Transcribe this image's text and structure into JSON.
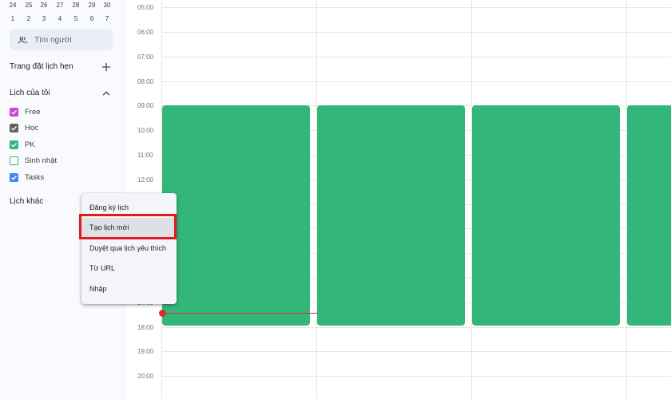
{
  "mini_calendar": {
    "row1": [
      "24",
      "25",
      "26",
      "27",
      "28",
      "29",
      "30"
    ],
    "row2": [
      "1",
      "2",
      "3",
      "4",
      "5",
      "6",
      "7"
    ]
  },
  "search_people": {
    "placeholder": "Tìm người"
  },
  "booking_pages": {
    "title": "Trang đặt lịch hẹn"
  },
  "my_calendars": {
    "title": "Lịch của tôi",
    "items": [
      {
        "label": "Free",
        "checked": true,
        "color": "#c548d1"
      },
      {
        "label": "Học",
        "checked": true,
        "color": "#616161"
      },
      {
        "label": "PK",
        "checked": true,
        "color": "#33b679"
      },
      {
        "label": "Sinh nhật",
        "checked": false,
        "color": "#33b679"
      },
      {
        "label": "Tasks",
        "checked": true,
        "color": "#4285f4"
      }
    ]
  },
  "other_calendars": {
    "title": "Lịch khác"
  },
  "menu": {
    "items": [
      "Đăng ký lịch",
      "Tạo lịch mới",
      "Duyệt qua lịch yêu thích",
      "Từ URL",
      "Nhập"
    ],
    "highlighted_index": 1
  },
  "time_labels": [
    "05:00",
    "06:00",
    "07:00",
    "08:00",
    "09:00",
    "10:00",
    "11:00",
    "12:00",
    "17:00",
    "18:00",
    "19:00",
    "20:00"
  ],
  "colors": {
    "event": "#33b679",
    "current_time": "#d93025",
    "highlight_box": "#e01b1b"
  }
}
